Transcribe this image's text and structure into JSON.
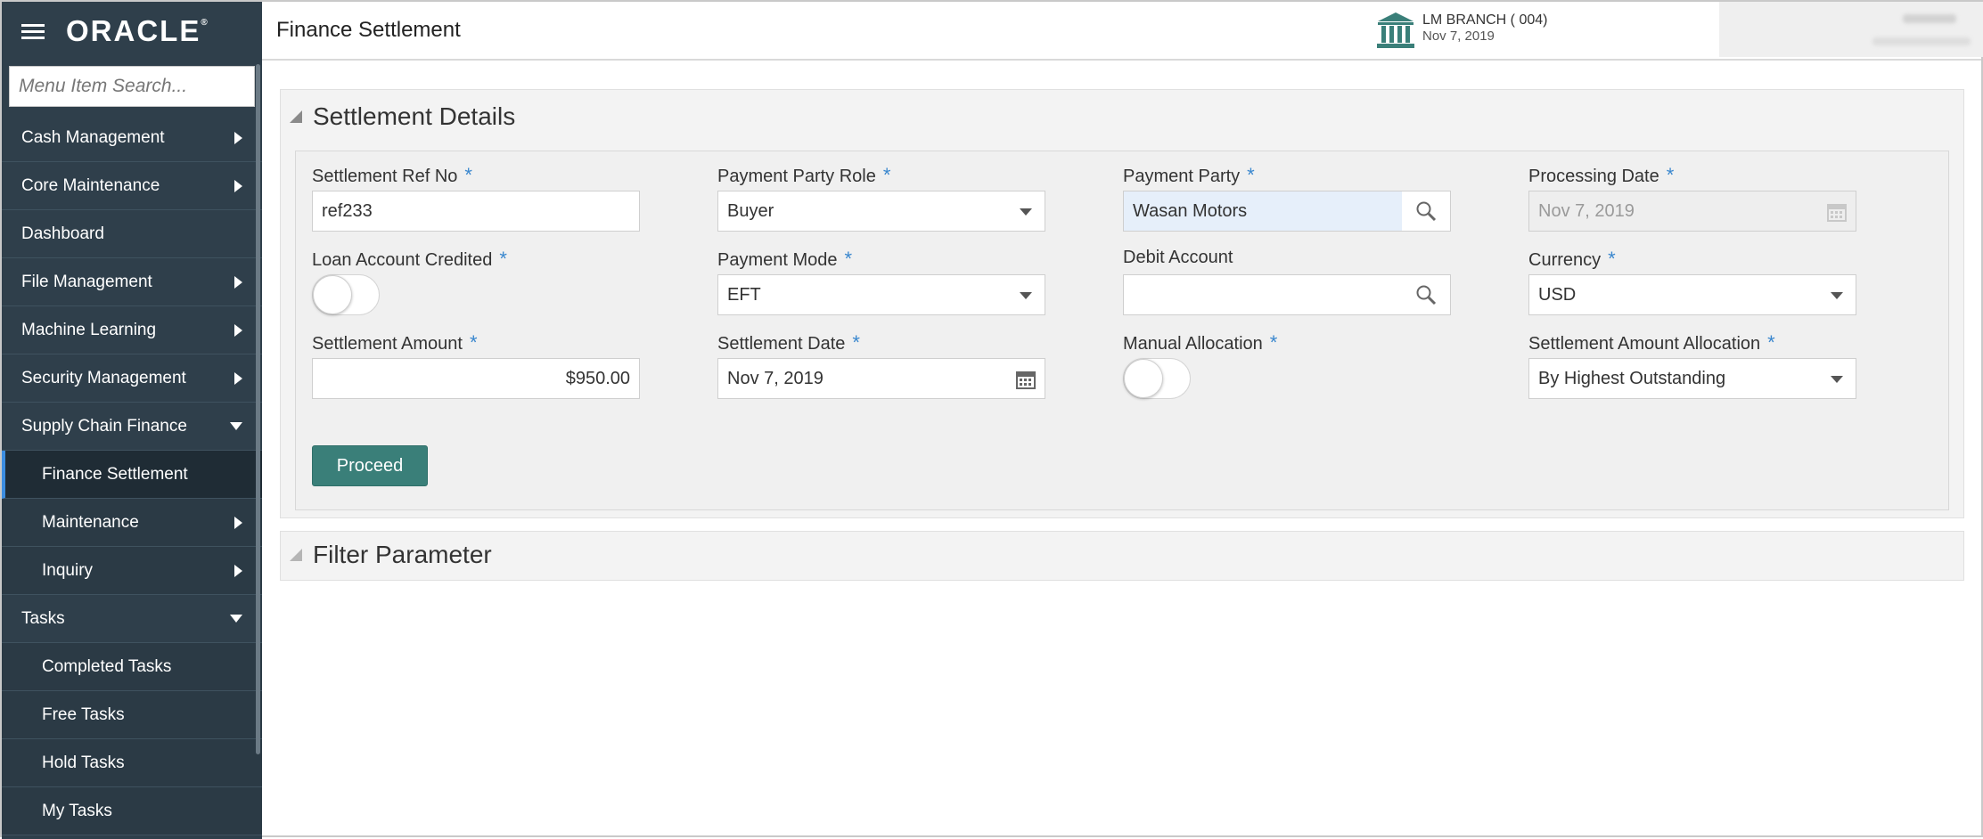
{
  "app": {
    "logo": "ORACLE"
  },
  "sidebar": {
    "search_placeholder": "Menu Item Search...",
    "items": [
      {
        "label": "Cash Management"
      },
      {
        "label": "Core Maintenance"
      },
      {
        "label": "Dashboard"
      },
      {
        "label": "File Management"
      },
      {
        "label": "Machine Learning"
      },
      {
        "label": "Security Management"
      },
      {
        "label": "Supply Chain Finance"
      },
      {
        "label": "Finance Settlement"
      },
      {
        "label": "Maintenance"
      },
      {
        "label": "Inquiry"
      },
      {
        "label": "Tasks"
      },
      {
        "label": "Completed Tasks"
      },
      {
        "label": "Free Tasks"
      },
      {
        "label": "Hold Tasks"
      },
      {
        "label": "My Tasks"
      }
    ]
  },
  "header": {
    "title": "Finance Settlement",
    "branch_name": "LM BRANCH  ( 004)",
    "branch_date": "Nov 7, 2019"
  },
  "settlement": {
    "section_title": "Settlement Details",
    "fields": {
      "ref_no": {
        "label": "Settlement Ref No",
        "value": "ref233"
      },
      "party_role": {
        "label": "Payment Party Role",
        "value": "Buyer"
      },
      "payment_party": {
        "label": "Payment Party",
        "value": "Wasan Motors"
      },
      "processing_date": {
        "label": "Processing Date",
        "value": "Nov 7, 2019"
      },
      "loan_account": {
        "label": "Loan Account Credited"
      },
      "payment_mode": {
        "label": "Payment Mode",
        "value": "EFT"
      },
      "debit_account": {
        "label": "Debit Account",
        "value": ""
      },
      "currency": {
        "label": "Currency",
        "value": "USD"
      },
      "amount": {
        "label": "Settlement Amount",
        "value": "$950.00"
      },
      "settlement_date": {
        "label": "Settlement Date",
        "value": "Nov 7, 2019"
      },
      "manual_allocation": {
        "label": "Manual Allocation"
      },
      "amount_allocation": {
        "label": "Settlement Amount Allocation",
        "value": "By Highest Outstanding"
      }
    },
    "required_mark": "*",
    "proceed_label": "Proceed"
  },
  "filter": {
    "section_title": "Filter Parameter"
  },
  "colors": {
    "sidebar_bg": "#2f3f4b",
    "accent": "#3a7f79",
    "required": "#3a87ce"
  }
}
